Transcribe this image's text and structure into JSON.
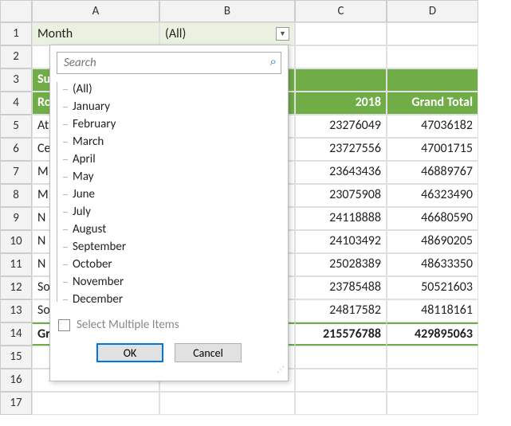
{
  "columns": [
    "A",
    "B",
    "C",
    "D"
  ],
  "row_count": 17,
  "filter": {
    "label": "Month",
    "value": "(All)"
  },
  "dropdown": {
    "search_placeholder": "Search",
    "items": [
      "(All)",
      "January",
      "February",
      "March",
      "April",
      "May",
      "June",
      "July",
      "August",
      "September",
      "October",
      "November",
      "December"
    ],
    "multi_label": "Select Multiple Items",
    "ok": "OK",
    "cancel": "Cancel"
  },
  "headers": {
    "row3a": "Su",
    "row4a": "Ro",
    "col_2018": "2018",
    "col_grand": "Grand Total"
  },
  "rows": [
    {
      "label": "At",
      "c": "23276049",
      "d": "47036182"
    },
    {
      "label": "Ce",
      "c": "23727556",
      "d": "47001715"
    },
    {
      "label": "M",
      "c": "23643436",
      "d": "46889767"
    },
    {
      "label": "M",
      "c": "23075908",
      "d": "46323490"
    },
    {
      "label": "N",
      "c": "24118888",
      "d": "46680590"
    },
    {
      "label": "N",
      "c": "24103492",
      "d": "48690205"
    },
    {
      "label": "N",
      "c": "25028389",
      "d": "48633350"
    },
    {
      "label": "So",
      "c": "23785488",
      "d": "50521603"
    },
    {
      "label": "So",
      "c": "24817582",
      "d": "48118161"
    }
  ],
  "grand": {
    "label": "Gr",
    "c": "215576788",
    "d": "429895063"
  }
}
